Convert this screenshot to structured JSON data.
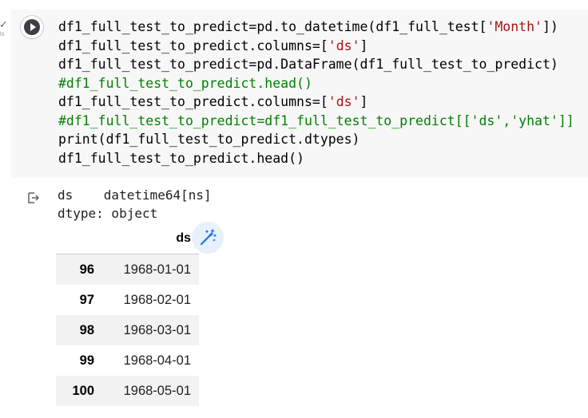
{
  "cell": {
    "status_check": "✓",
    "status_label": "0s",
    "code_lines": [
      [
        {
          "t": "df1_full_test_to_predict=pd.to_datetime(df1_full_test[",
          "k": "p"
        },
        {
          "t": "'Month'",
          "k": "s"
        },
        {
          "t": "])",
          "k": "p"
        }
      ],
      [
        {
          "t": "df1_full_test_to_predict.columns=[",
          "k": "p"
        },
        {
          "t": "'ds'",
          "k": "s"
        },
        {
          "t": "]",
          "k": "p"
        }
      ],
      [
        {
          "t": "df1_full_test_to_predict=pd.DataFrame(df1_full_test_to_predict)",
          "k": "p"
        }
      ],
      [
        {
          "t": "#df1_full_test_to_predict.head()",
          "k": "c"
        }
      ],
      [
        {
          "t": "df1_full_test_to_predict.columns=[",
          "k": "p"
        },
        {
          "t": "'ds'",
          "k": "s"
        },
        {
          "t": "]",
          "k": "p"
        }
      ],
      [
        {
          "t": "#df1_full_test_to_predict=df1_full_test_to_predict[['ds','yhat']]",
          "k": "c"
        }
      ],
      [
        {
          "t": "print(df1_full_test_to_predict.dtypes)",
          "k": "p"
        }
      ],
      [
        {
          "t": "df1_full_test_to_predict.head()",
          "k": "p"
        }
      ]
    ]
  },
  "output": {
    "stdout": [
      "ds    datetime64[ns]",
      "dtype: object"
    ],
    "table": {
      "column": "ds",
      "rows": [
        {
          "index": "96",
          "ds": "1968-01-01"
        },
        {
          "index": "97",
          "ds": "1968-02-01"
        },
        {
          "index": "98",
          "ds": "1968-03-01"
        },
        {
          "index": "99",
          "ds": "1968-04-01"
        },
        {
          "index": "100",
          "ds": "1968-05-01"
        }
      ]
    }
  },
  "icons": {
    "run": "play-icon",
    "output": "output-redirect-icon",
    "suggest": "magic-wand-icon"
  },
  "colors": {
    "code_bg": "#f7f7f7",
    "string": "#a31515",
    "comment": "#008000",
    "run_button": "#3c4043",
    "wand_bg": "#e8f0fe",
    "wand": "#1a73e8",
    "row_stripe": "#f2f2f2"
  }
}
